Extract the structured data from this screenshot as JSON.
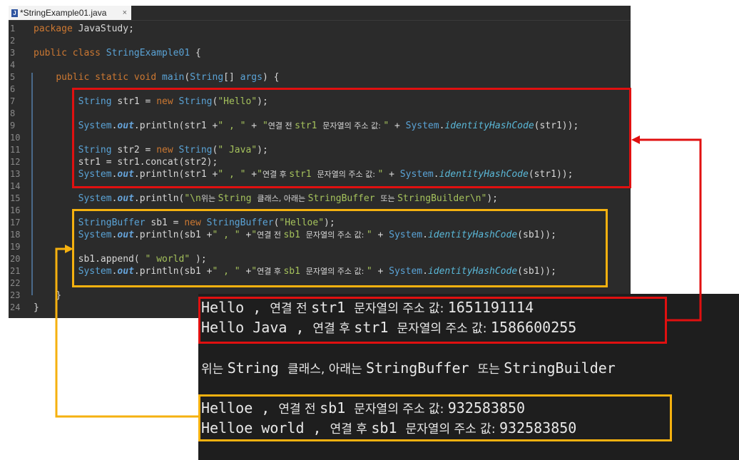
{
  "tab": {
    "title": "*StringExample01.java",
    "close": "×"
  },
  "code": [
    {
      "n": "1",
      "t": [
        [
          "kw",
          "package"
        ],
        [
          "",
          ""
        ],
        [
          "",
          "JavaStudy;"
        ]
      ]
    },
    {
      "n": "2",
      "t": []
    },
    {
      "n": "3",
      "t": [
        [
          "kw",
          "public"
        ],
        [
          "",
          ""
        ],
        [
          "kw",
          "class"
        ],
        [
          "",
          ""
        ],
        [
          "ty",
          "StringExample01"
        ],
        [
          "",
          " {"
        ]
      ]
    },
    {
      "n": "4",
      "t": []
    },
    {
      "n": "5",
      "t": [
        [
          "",
          "    "
        ],
        [
          "kw",
          "public"
        ],
        [
          "",
          ""
        ],
        [
          "kw",
          "static"
        ],
        [
          "",
          ""
        ],
        [
          "kw",
          "void"
        ],
        [
          "",
          " "
        ],
        [
          "ty",
          "main"
        ],
        [
          "",
          "("
        ],
        [
          "ty",
          "String"
        ],
        [
          "",
          "[] "
        ],
        [
          "ty",
          "args"
        ],
        [
          "",
          ") {"
        ]
      ]
    },
    {
      "n": "6",
      "t": []
    },
    {
      "n": "7",
      "t": [
        [
          "",
          "        "
        ],
        [
          "ty",
          "String"
        ],
        [
          "",
          " str1 = "
        ],
        [
          "kw",
          "new"
        ],
        [
          "",
          " "
        ],
        [
          "ty",
          "String"
        ],
        [
          "",
          "("
        ],
        [
          "st",
          "\"Hello\""
        ],
        [
          "",
          ");"
        ]
      ]
    },
    {
      "n": "8",
      "t": []
    },
    {
      "n": "9",
      "t": [
        [
          "",
          "        "
        ],
        [
          "ty",
          "System"
        ],
        [
          "",
          "."
        ],
        [
          "fd",
          "out"
        ],
        [
          "",
          ".println(str1 +"
        ],
        [
          "st",
          "\" , \""
        ],
        [
          "",
          " + "
        ],
        [
          "st",
          "\""
        ],
        [
          "ko",
          "연결 전 "
        ],
        [
          "st",
          "str1 "
        ],
        [
          "ko",
          "문자열의 주소 값: "
        ],
        [
          "st",
          "\""
        ],
        [
          "",
          " + "
        ],
        [
          "ty",
          "System"
        ],
        [
          "",
          "."
        ],
        [
          "mt",
          "identityHashCode"
        ],
        [
          "",
          "(str1));"
        ]
      ]
    },
    {
      "n": "10",
      "t": []
    },
    {
      "n": "11",
      "t": [
        [
          "",
          "        "
        ],
        [
          "ty",
          "String"
        ],
        [
          "",
          " str2 = "
        ],
        [
          "kw",
          "new"
        ],
        [
          "",
          " "
        ],
        [
          "ty",
          "String"
        ],
        [
          "",
          "("
        ],
        [
          "st",
          "\" Java\""
        ],
        [
          "",
          ");"
        ]
      ]
    },
    {
      "n": "12",
      "t": [
        [
          "",
          "        str1 = str1.concat(str2);"
        ]
      ]
    },
    {
      "n": "13",
      "t": [
        [
          "",
          "        "
        ],
        [
          "ty",
          "System"
        ],
        [
          "",
          "."
        ],
        [
          "fd",
          "out"
        ],
        [
          "",
          ".println(str1 +"
        ],
        [
          "st",
          "\" , \""
        ],
        [
          "",
          " +"
        ],
        [
          "st",
          "\""
        ],
        [
          "ko",
          "연결 후 "
        ],
        [
          "st",
          "str1 "
        ],
        [
          "ko",
          "문자열의 주소 값: "
        ],
        [
          "st",
          "\""
        ],
        [
          "",
          " + "
        ],
        [
          "ty",
          "System"
        ],
        [
          "",
          "."
        ],
        [
          "mt",
          "identityHashCode"
        ],
        [
          "",
          "(str1));"
        ]
      ]
    },
    {
      "n": "14",
      "t": []
    },
    {
      "n": "15",
      "t": [
        [
          "",
          "        "
        ],
        [
          "ty",
          "System"
        ],
        [
          "",
          "."
        ],
        [
          "fd",
          "out"
        ],
        [
          "",
          ".println("
        ],
        [
          "st",
          "\"\\n"
        ],
        [
          "ko",
          "위는 "
        ],
        [
          "st",
          "String "
        ],
        [
          "ko",
          "클래스, 아래는 "
        ],
        [
          "st",
          "StringBuffer "
        ],
        [
          "ko",
          "또는 "
        ],
        [
          "st",
          "StringBuilder\\n\""
        ],
        [
          "",
          ");"
        ]
      ]
    },
    {
      "n": "16",
      "t": []
    },
    {
      "n": "17",
      "t": [
        [
          "",
          "        "
        ],
        [
          "ty",
          "StringBuffer"
        ],
        [
          "",
          " sb1 = "
        ],
        [
          "kw",
          "new"
        ],
        [
          "",
          " "
        ],
        [
          "ty",
          "StringBuffer"
        ],
        [
          "",
          "("
        ],
        [
          "st",
          "\"Helloe\""
        ],
        [
          "",
          ");"
        ]
      ]
    },
    {
      "n": "18",
      "t": [
        [
          "",
          "        "
        ],
        [
          "ty",
          "System"
        ],
        [
          "",
          "."
        ],
        [
          "fd",
          "out"
        ],
        [
          "",
          ".println(sb1 +"
        ],
        [
          "st",
          "\" , \""
        ],
        [
          "",
          " +"
        ],
        [
          "st",
          "\""
        ],
        [
          "ko",
          "연결 전 "
        ],
        [
          "st",
          "sb1 "
        ],
        [
          "ko",
          "문자열의 주소 값: "
        ],
        [
          "st",
          "\""
        ],
        [
          "",
          " + "
        ],
        [
          "ty",
          "System"
        ],
        [
          "",
          "."
        ],
        [
          "mt",
          "identityHashCode"
        ],
        [
          "",
          "(sb1));"
        ]
      ]
    },
    {
      "n": "19",
      "t": []
    },
    {
      "n": "20",
      "t": [
        [
          "",
          "        sb1.append( "
        ],
        [
          "st",
          "\" world\""
        ],
        [
          "",
          " );"
        ]
      ]
    },
    {
      "n": "21",
      "t": [
        [
          "",
          "        "
        ],
        [
          "ty",
          "System"
        ],
        [
          "",
          "."
        ],
        [
          "fd",
          "out"
        ],
        [
          "",
          ".println(sb1 +"
        ],
        [
          "st",
          "\" , \""
        ],
        [
          "",
          " +"
        ],
        [
          "st",
          "\""
        ],
        [
          "ko",
          "연결 후 "
        ],
        [
          "st",
          "sb1 "
        ],
        [
          "ko",
          "문자열의 주소 값: "
        ],
        [
          "st",
          "\""
        ],
        [
          "",
          " + "
        ],
        [
          "ty",
          "System"
        ],
        [
          "",
          "."
        ],
        [
          "mt",
          "identityHashCode"
        ],
        [
          "",
          "(sb1));"
        ]
      ]
    },
    {
      "n": "22",
      "t": []
    },
    {
      "n": "23",
      "t": [
        [
          "",
          "    }"
        ]
      ]
    },
    {
      "n": "24",
      "t": [
        [
          "",
          "}"
        ]
      ]
    }
  ],
  "console": [
    [
      [
        "",
        "Hello , "
      ],
      [
        "ko",
        "연결 전 "
      ],
      [
        "",
        "str1 "
      ],
      [
        "ko",
        "문자열의 주소 값: "
      ],
      [
        "",
        "1651191114"
      ]
    ],
    [
      [
        "",
        "Hello Java , "
      ],
      [
        "ko",
        "연결 후 "
      ],
      [
        "",
        "str1 "
      ],
      [
        "ko",
        "문자열의 주소 값: "
      ],
      [
        "",
        "1586600255"
      ]
    ],
    [],
    [
      [
        "ko",
        "위는 "
      ],
      [
        "",
        "String "
      ],
      [
        "ko",
        "클래스, 아래는 "
      ],
      [
        "",
        "StringBuffer "
      ],
      [
        "ko",
        "또는 "
      ],
      [
        "",
        "StringBuilder"
      ]
    ],
    [],
    [
      [
        "",
        "Helloe , "
      ],
      [
        "ko",
        "연결 전 "
      ],
      [
        "",
        "sb1 "
      ],
      [
        "ko",
        "문자열의 주소 값: "
      ],
      [
        "",
        "932583850"
      ]
    ],
    [
      [
        "",
        "Helloe world , "
      ],
      [
        "ko",
        "연결 후 "
      ],
      [
        "",
        "sb1 "
      ],
      [
        "ko",
        "문자열의 주소 값: "
      ],
      [
        "",
        "932583850"
      ]
    ]
  ],
  "colors": {
    "red_box": "#e01010",
    "orange_box": "#f5b10f",
    "editor_bg": "#2b2b2b",
    "console_bg": "#1e1e1e"
  }
}
